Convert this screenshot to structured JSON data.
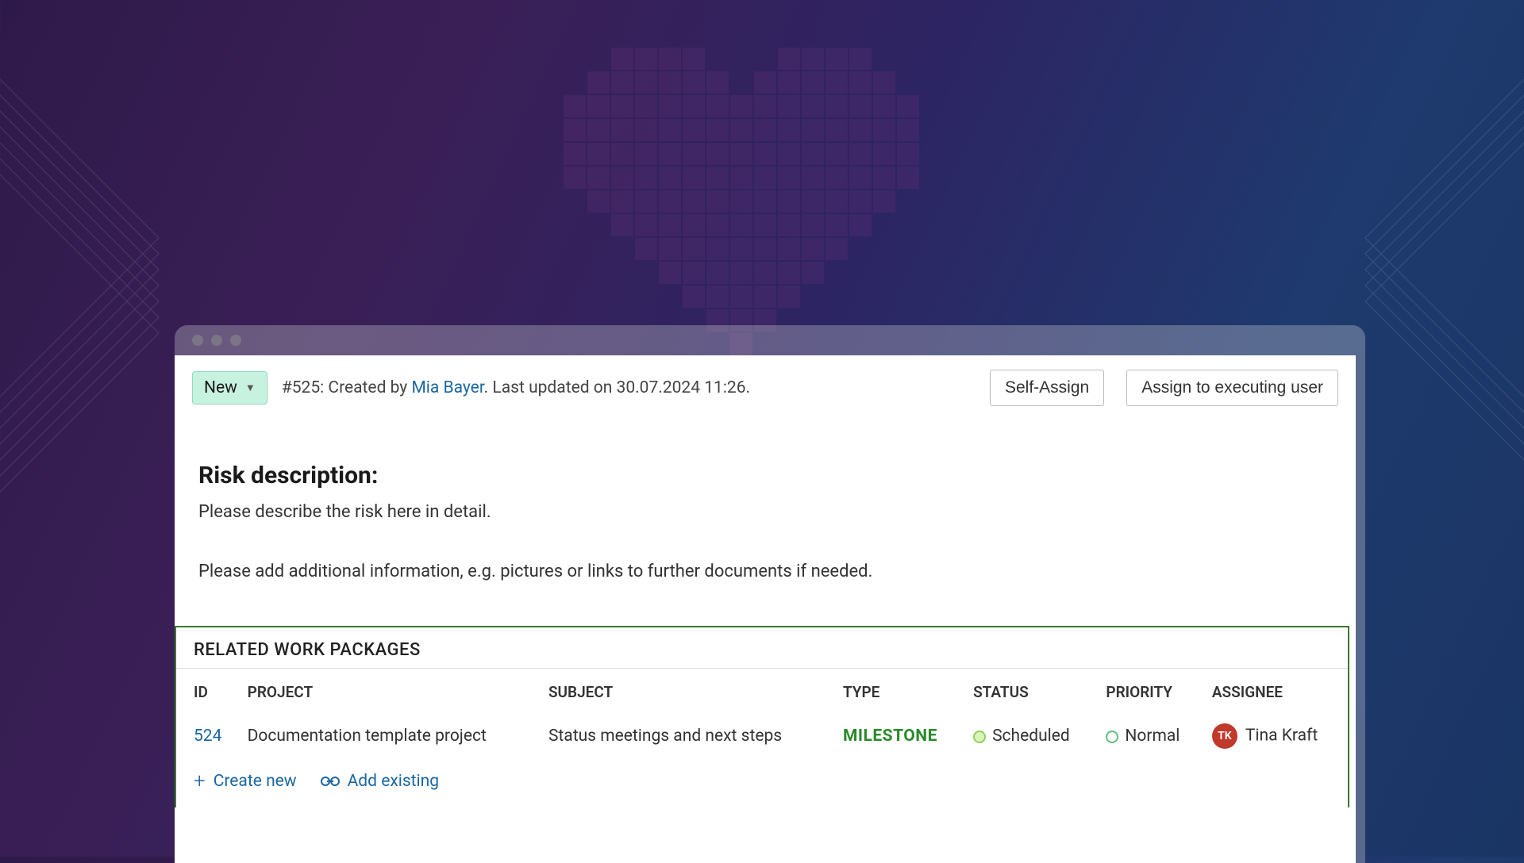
{
  "header": {
    "status_label": "New",
    "meta_prefix": "#525: Created by ",
    "author": "Mia Bayer",
    "meta_suffix": ". Last updated on 30.07.2024 11:26.",
    "self_assign_label": "Self-Assign",
    "assign_executing_label": "Assign to executing user"
  },
  "description": {
    "heading": "Risk description:",
    "line1": "Please describe the risk here in detail.",
    "line2": "Please add additional information, e.g. pictures or links to further documents if needed."
  },
  "related": {
    "title": "RELATED WORK PACKAGES",
    "columns": {
      "id": "ID",
      "project": "PROJECT",
      "subject": "SUBJECT",
      "type": "TYPE",
      "status": "STATUS",
      "priority": "PRIORITY",
      "assignee": "ASSIGNEE"
    },
    "rows": [
      {
        "id": "524",
        "project": "Documentation template project",
        "subject": "Status meetings and next steps",
        "type": "MILESTONE",
        "status": "Scheduled",
        "priority": "Normal",
        "assignee_initials": "TK",
        "assignee_name": "Tina Kraft"
      }
    ],
    "create_new_label": "Create new",
    "add_existing_label": "Add existing"
  }
}
